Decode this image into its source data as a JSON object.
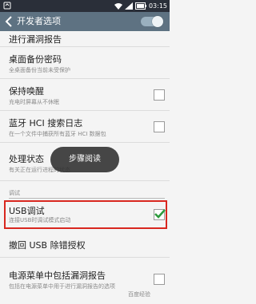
{
  "status_bar": {
    "time": "03:15"
  },
  "app_bar": {
    "title": "开发者选项",
    "toggle_on": true
  },
  "items": [
    {
      "title": "进行漏洞报告"
    },
    {
      "title": "桌面备份密码",
      "summary": "全桌面备份当前未受保护"
    },
    {
      "title": "保持唤醒",
      "summary": "充电时屏幕从不休眠",
      "checked": false
    },
    {
      "title": "蓝牙 HCI 搜索日志",
      "summary": "在一个文件中捕获所有蓝牙 HCI 数据包",
      "checked": false
    },
    {
      "title": "处理状态",
      "summary": "有关正在运行进程的状态"
    },
    {
      "title": "USB调试",
      "summary": "连接USB时调试模式启动",
      "checked": true
    },
    {
      "title": "撤回 USB 除错授权"
    },
    {
      "title": "电源菜单中包括漏洞报告",
      "summary": "包括在电源菜单中用于进行漏洞报告的选项",
      "checked": false
    }
  ],
  "section_header": "调试",
  "toast": "步骤阅读",
  "watermark": "百度经验",
  "colors": {
    "appbar": "#5e7282",
    "highlight": "#d9271f",
    "check": "#2c9a3c"
  }
}
